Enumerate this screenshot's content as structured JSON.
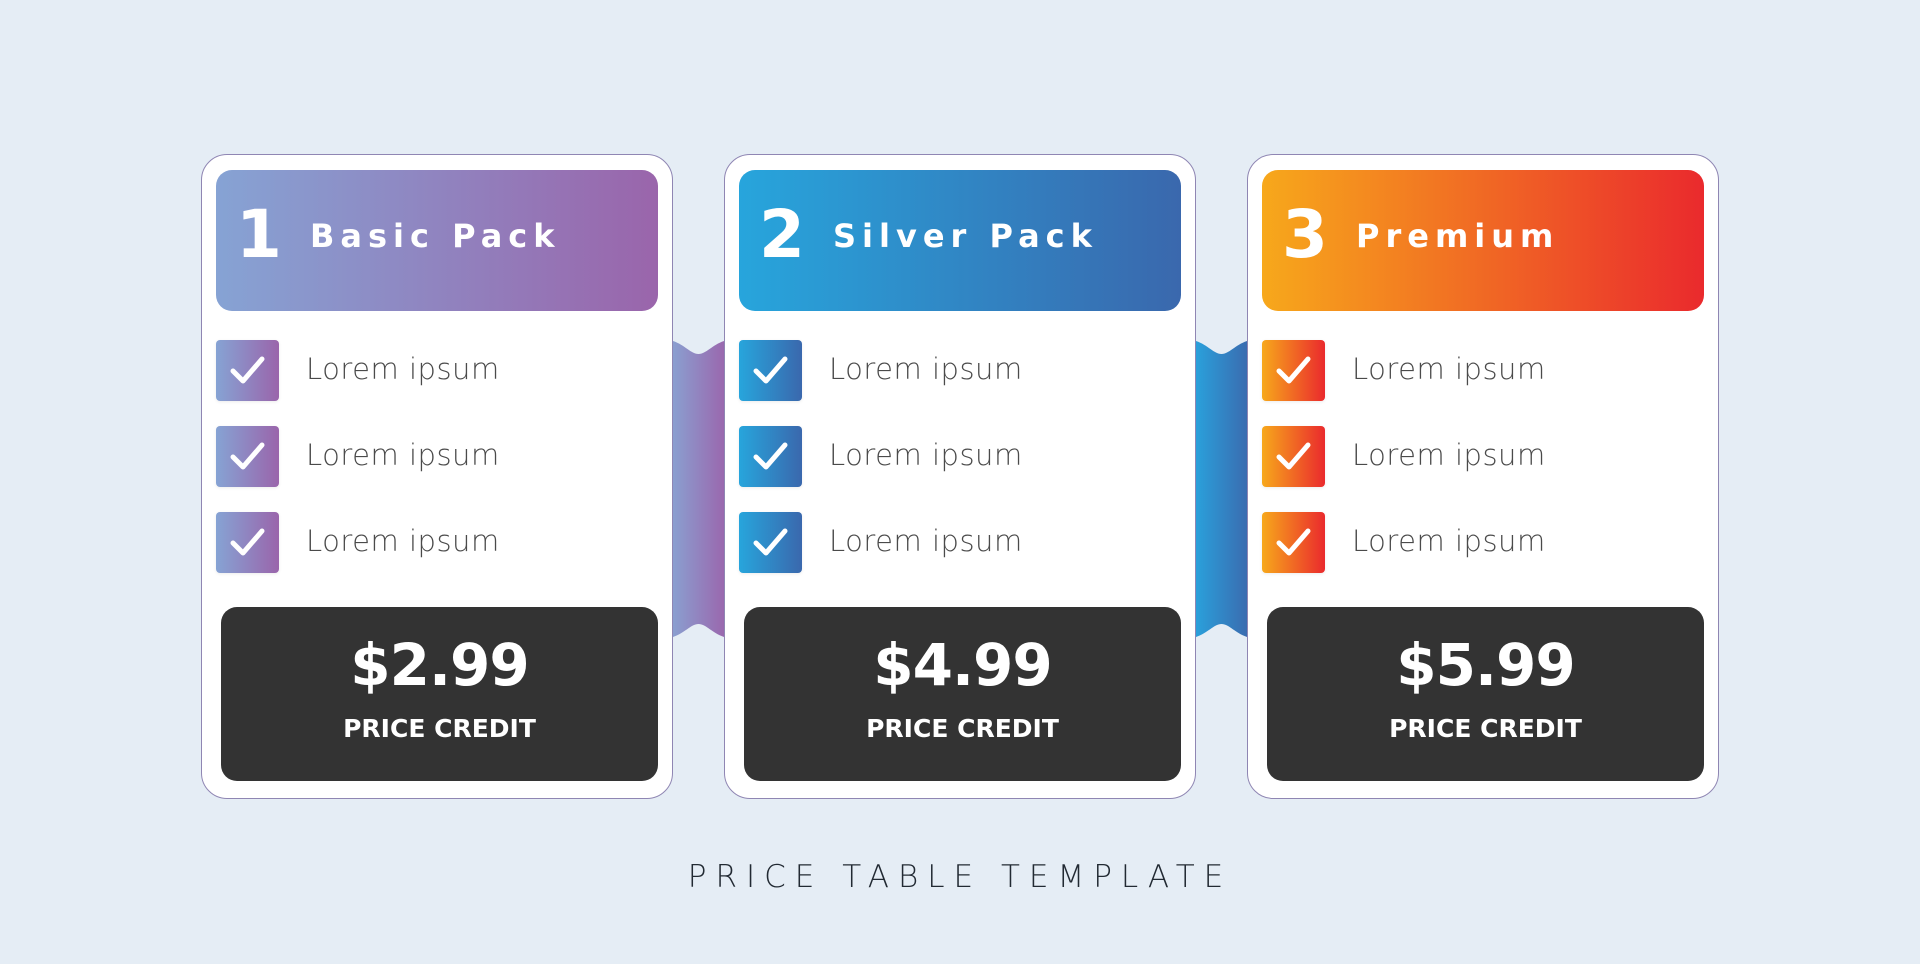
{
  "background_color": "#e5edf5",
  "plans": [
    {
      "number": "1",
      "name": "Basic Pack",
      "gradient_start": "#86a3d4",
      "gradient_end": "#9a65ab",
      "features": [
        "Lorem ipsum",
        "Lorem ipsum",
        "Lorem ipsum"
      ],
      "price": "$2.99",
      "price_caption": "PRICE CREDIT"
    },
    {
      "number": "2",
      "name": "Silver Pack",
      "gradient_start": "#27a5dc",
      "gradient_end": "#3a68ad",
      "features": [
        "Lorem ipsum",
        "Lorem ipsum",
        "Lorem ipsum"
      ],
      "price": "$4.99",
      "price_caption": "PRICE CREDIT"
    },
    {
      "number": "3",
      "name": "Premium",
      "gradient_start": "#f7a81b",
      "gradient_end": "#ea2a2d",
      "features": [
        "Lorem ipsum",
        "Lorem ipsum",
        "Lorem ipsum"
      ],
      "price": "$5.99",
      "price_caption": "PRICE CREDIT"
    }
  ],
  "connectors": [
    {
      "gradient_start": "#8a9fd0",
      "gradient_end": "#9a68ae"
    },
    {
      "gradient_start": "#2aa0db",
      "gradient_end": "#3a6cb0"
    }
  ],
  "price_box_color": "#333333",
  "icons": {
    "check": "check-mark"
  },
  "footer": {
    "title": "PRICE TABLE TEMPLATE"
  }
}
